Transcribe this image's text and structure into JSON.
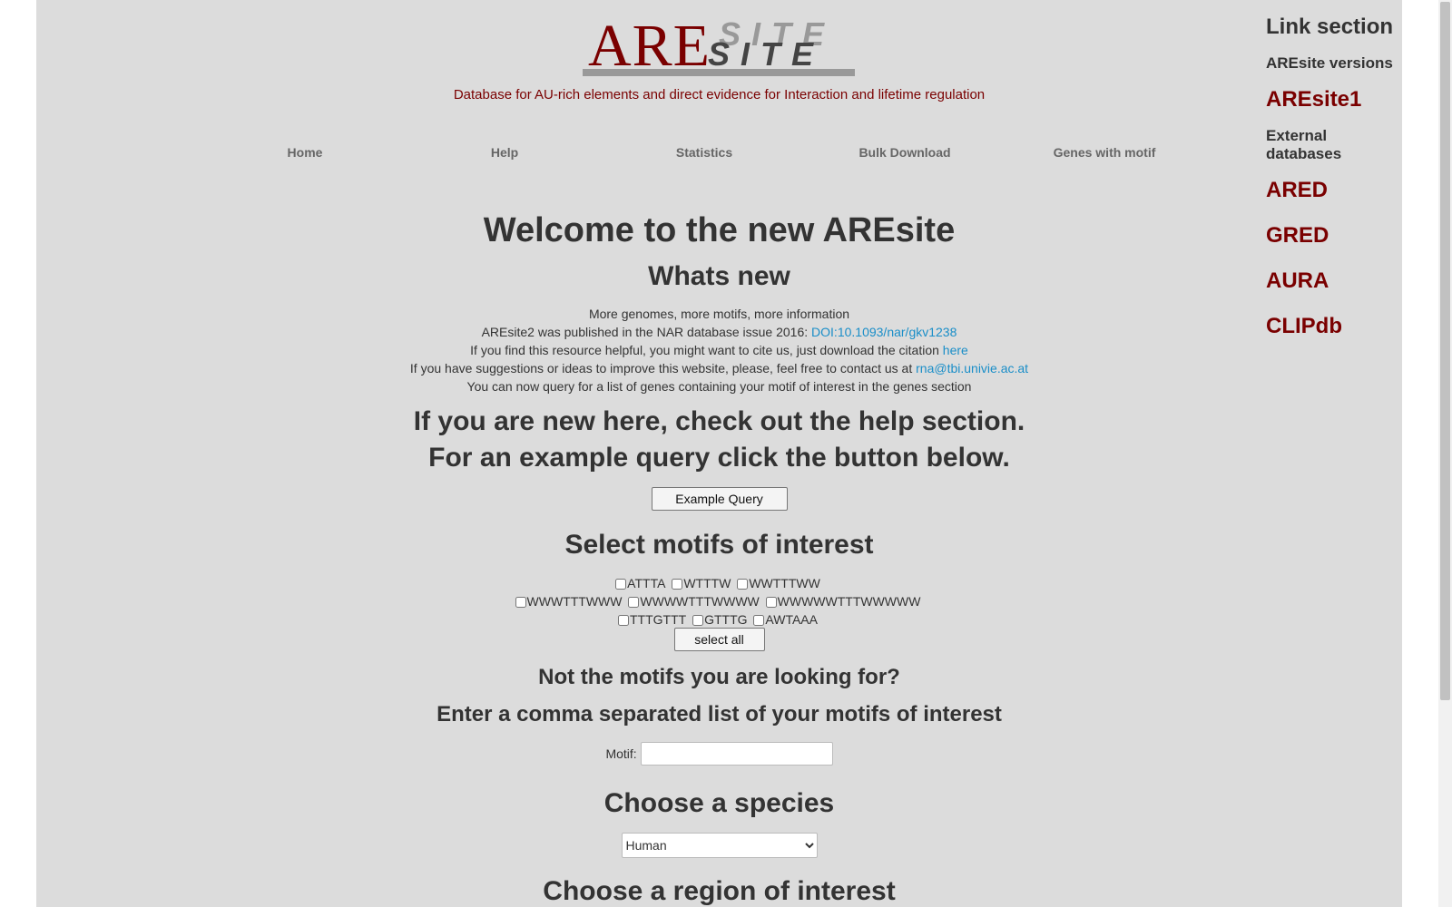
{
  "logo": {
    "main": "ARE",
    "site_back": "SITE",
    "site_front": "SITE"
  },
  "tagline": "Database for AU-rich elements and direct evidence for Interaction and lifetime regulation",
  "nav": [
    {
      "label": "Home"
    },
    {
      "label": "Help"
    },
    {
      "label": "Statistics"
    },
    {
      "label": "Bulk Download"
    },
    {
      "label": "Genes with motif"
    }
  ],
  "welcome_title": "Welcome to the new AREsite",
  "whats_new_title": "Whats new",
  "news": {
    "line1": "More genomes, more motifs, more information",
    "line2_prefix": "AREsite2 was published in the NAR database issue 2016: ",
    "line2_link": "DOI:10.1093/nar/gkv1238",
    "line3_prefix": "If you find this resource helpful, you might want to cite us, just download the citation ",
    "line3_link": "here",
    "line4_prefix": "If you have suggestions or ideas to improve this website, please, feel free to contact us at ",
    "line4_link": "rna@tbi.univie.ac.at",
    "line5": "You can now query for a list of genes containing your motif of interest in the genes section"
  },
  "help_hint": "If you are new here, check out the help section.",
  "example_hint": "For an example query click the button below.",
  "example_button": "Example Query",
  "motifs_title": "Select motifs of interest",
  "motifs_row1": [
    "ATTTA",
    "WTTTW",
    "WWTTTWW"
  ],
  "motifs_row2": [
    "WWWTTTWWW",
    "WWWWTTTWWWW",
    "WWWWWTTTWWWWW"
  ],
  "motifs_row3": [
    "TTTGTTT",
    "GTTTG",
    "AWTAAA"
  ],
  "select_all": "select all",
  "not_motifs_title": "Not the motifs you are looking for?",
  "enter_motifs_title": "Enter a comma separated list of your motifs of interest",
  "motif_label": "Motif:",
  "motif_value": "",
  "species_title": "Choose a species",
  "species_selected": "Human",
  "region_title": "Choose a region of interest",
  "sidebar": {
    "title": "Link section",
    "versions_heading": "AREsite versions",
    "aresite1": "AREsite1",
    "external_heading": "External databases",
    "links": [
      "ARED",
      "GRED",
      "AURA",
      "CLIPdb"
    ]
  },
  "colors": {
    "brand": "#7a0000",
    "link": "#1a8ec8",
    "page_bg": "#dcdcdc"
  }
}
